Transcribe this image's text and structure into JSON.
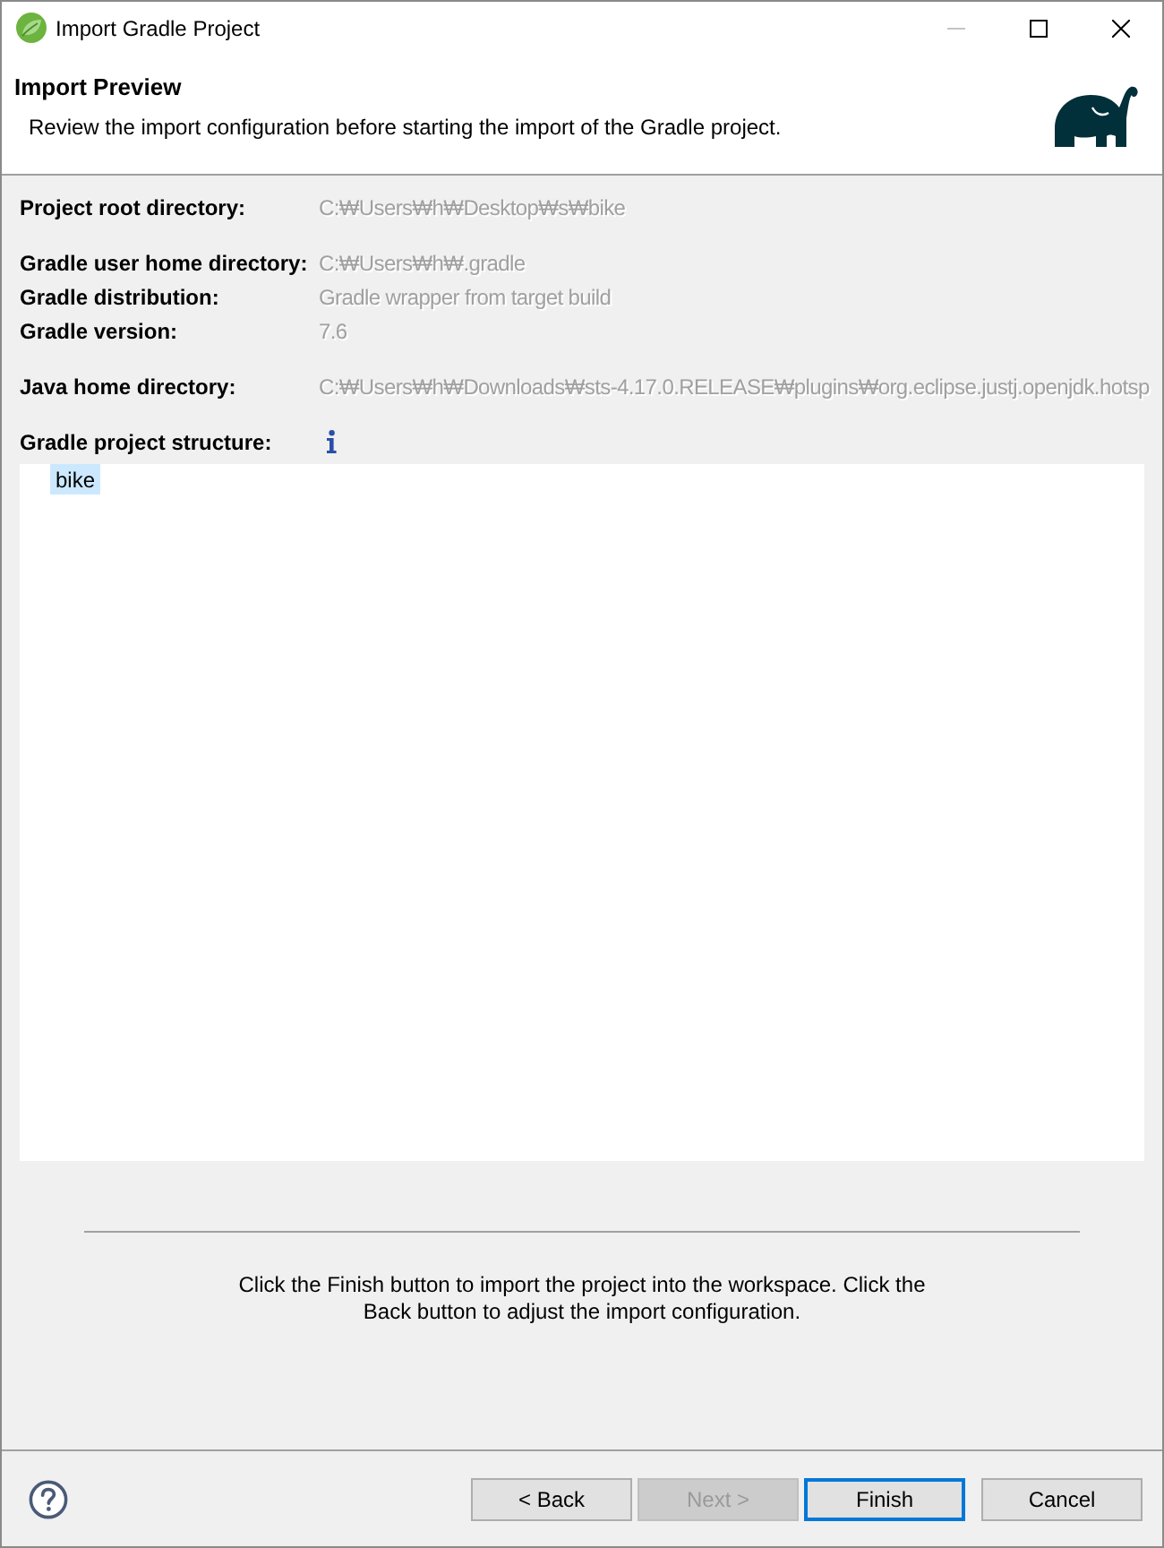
{
  "window": {
    "title": "Import Gradle Project",
    "controls": [
      {
        "kind": "minimize",
        "disabled": true
      },
      {
        "kind": "maximize",
        "disabled": false
      },
      {
        "kind": "close",
        "disabled": false
      }
    ]
  },
  "header": {
    "title": "Import Preview",
    "description": "Review the import configuration before starting the import of the Gradle project."
  },
  "field_groups": [
    {
      "fields": [
        {
          "label": "Project root directory:",
          "value": "C:₩Users₩h₩Desktop₩s₩bike"
        }
      ]
    },
    {
      "fields": [
        {
          "label": "Gradle user home directory:",
          "value": "C:₩Users₩h₩.gradle"
        },
        {
          "label": "Gradle distribution:",
          "value": "Gradle wrapper from target build"
        },
        {
          "label": "Gradle version:",
          "value": "7.6"
        }
      ]
    },
    {
      "fields": [
        {
          "label": "Java home directory:",
          "value": "C:₩Users₩h₩Downloads₩sts-4.17.0.RELEASE₩plugins₩org.eclipse.justj.openjdk.hotsp"
        }
      ]
    }
  ],
  "project_structure": {
    "label": "Gradle project structure:",
    "tree": [
      {
        "label": "bike",
        "selected": true
      }
    ]
  },
  "message": "Click the Finish button to import the project into the workspace. Click the Back button to adjust the import configuration.",
  "buttons": [
    {
      "label": "< Back",
      "disabled": false,
      "focused": false
    },
    {
      "label": "Next >",
      "disabled": true,
      "focused": false
    },
    {
      "label": "Finish",
      "disabled": false,
      "focused": true
    },
    {
      "label": "Cancel",
      "disabled": false,
      "focused": false
    }
  ]
}
